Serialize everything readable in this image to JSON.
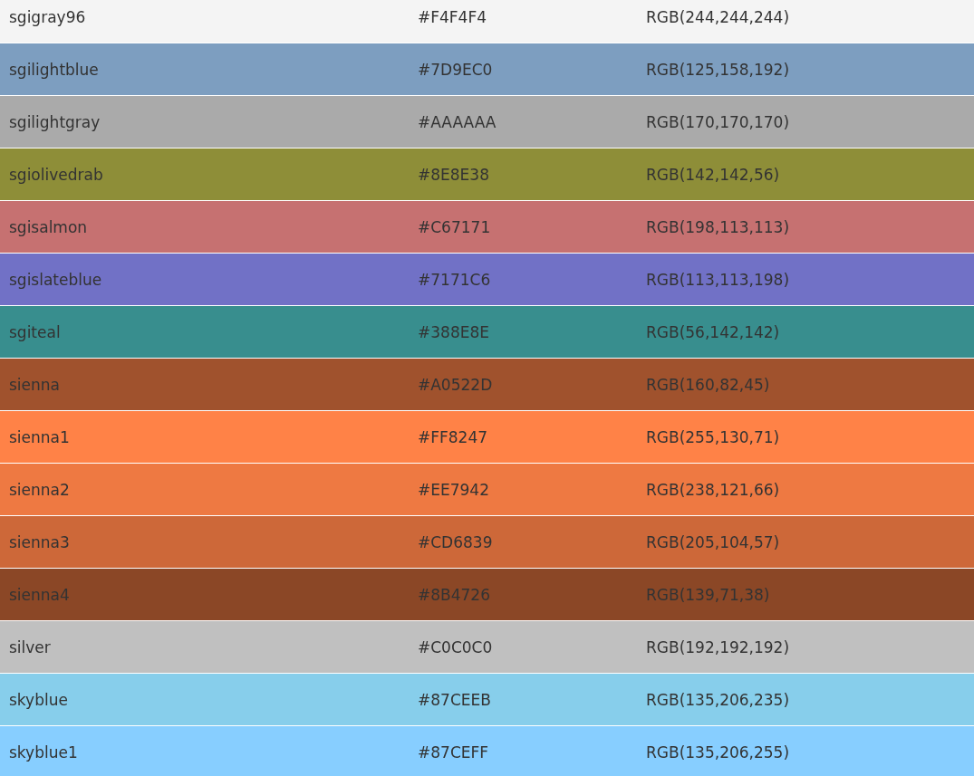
{
  "table": {
    "rows": [
      {
        "name": "sgigray96",
        "hex": "#F4F4F4",
        "rgb": "RGB(244,244,244)",
        "color": "#f4f4f4"
      },
      {
        "name": "sgilightblue",
        "hex": "#7D9EC0",
        "rgb": "RGB(125,158,192)",
        "color": "#7d9ec0"
      },
      {
        "name": "sgilightgray",
        "hex": "#AAAAAA",
        "rgb": "RGB(170,170,170)",
        "color": "#aaaaaa"
      },
      {
        "name": "sgiolivedrab",
        "hex": "#8E8E38",
        "rgb": "RGB(142,142,56)",
        "color": "#8e8e38"
      },
      {
        "name": "sgisalmon",
        "hex": "#C67171",
        "rgb": "RGB(198,113,113)",
        "color": "#c67171"
      },
      {
        "name": "sgislateblue",
        "hex": "#7171C6",
        "rgb": "RGB(113,113,198)",
        "color": "#7171c6"
      },
      {
        "name": "sgiteal",
        "hex": "#388E8E",
        "rgb": "RGB(56,142,142)",
        "color": "#388e8e"
      },
      {
        "name": "sienna",
        "hex": "#A0522D",
        "rgb": "RGB(160,82,45)",
        "color": "#a0522d"
      },
      {
        "name": "sienna1",
        "hex": "#FF8247",
        "rgb": "RGB(255,130,71)",
        "color": "#ff8247"
      },
      {
        "name": "sienna2",
        "hex": "#EE7942",
        "rgb": "RGB(238,121,66)",
        "color": "#ee7942"
      },
      {
        "name": "sienna3",
        "hex": "#CD6839",
        "rgb": "RGB(205,104,57)",
        "color": "#cd6839"
      },
      {
        "name": "sienna4",
        "hex": "#8B4726",
        "rgb": "RGB(139,71,38)",
        "color": "#8b4726"
      },
      {
        "name": "silver",
        "hex": "#C0C0C0",
        "rgb": "RGB(192,192,192)",
        "color": "#c0c0c0"
      },
      {
        "name": "skyblue",
        "hex": "#87CEEB",
        "rgb": "RGB(135,206,235)",
        "color": "#87ceeb"
      },
      {
        "name": "skyblue1",
        "hex": "#87CEFF",
        "rgb": "RGB(135,206,255)",
        "color": "#87ceff"
      }
    ]
  }
}
